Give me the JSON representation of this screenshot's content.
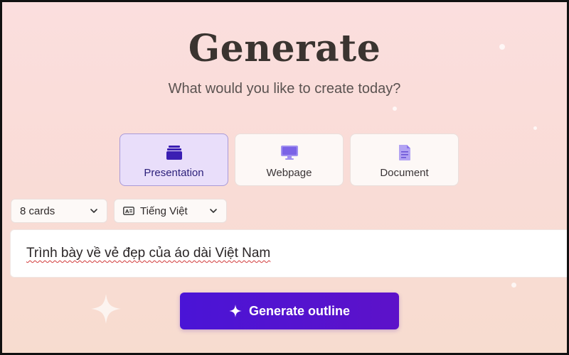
{
  "header": {
    "title": "Generate",
    "subtitle": "What would you like to create today?"
  },
  "types": [
    {
      "label": "Presentation",
      "icon": "presentation-icon",
      "selected": true
    },
    {
      "label": "Webpage",
      "icon": "monitor-icon",
      "selected": false
    },
    {
      "label": "Document",
      "icon": "document-icon",
      "selected": false
    }
  ],
  "options": {
    "cards": "8 cards",
    "language": "Tiếng Việt",
    "language_icon": "language-icon"
  },
  "prompt": {
    "value": "Trình bày về vẻ đẹp của áo dài Việt Nam"
  },
  "action": {
    "label": "Generate outline",
    "icon": "sparkle-icon"
  },
  "colors": {
    "accent": "#4a14d6",
    "selected_card_bg": "#e9defa",
    "background": "#fbdede"
  }
}
